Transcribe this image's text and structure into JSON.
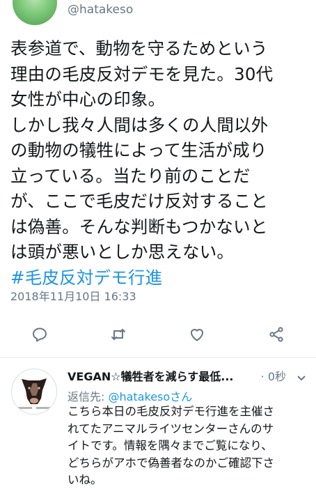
{
  "tweet": {
    "handle": "@hatakeso",
    "text": "表参道で、動物を守るためという\n理由の毛皮反対デモを見た。30代\n女性が中心の印象。\nしかし我々人間は多くの人間以外\nの動物の犠牲によって生活が成り\n立っている。当たり前のことだ\nが、ここで毛皮だけ反対すること\nは偽善。そんな判断もつかないと\nは頭が悪いとしか思えない。",
    "hashtag": "#毛皮反対デモ行進",
    "timestamp": "2018年11月10日 16:33",
    "actions": [
      "reply-icon",
      "retweet-icon",
      "like-icon",
      "share-icon"
    ]
  },
  "reply": {
    "author_name": "VEGAN☆犠牲者を減らす最低...",
    "time": "· 0秒",
    "reply_to_label": "返信先: ",
    "reply_to_handle": "@hatakeso",
    "reply_to_suffix": "さん",
    "text": "こちら本日の毛皮反対デモ行進を主催さ\nれてたアニマルライツセンターさんのサ\nイトです。情報を隅々までご覧になり、\nどちらがアホで偽善者なのかご確認下さ\nいね。"
  },
  "colors": {
    "text": "#14171a",
    "secondary": "#657786",
    "link": "#1b95e0",
    "divider": "#e1e8ed"
  }
}
